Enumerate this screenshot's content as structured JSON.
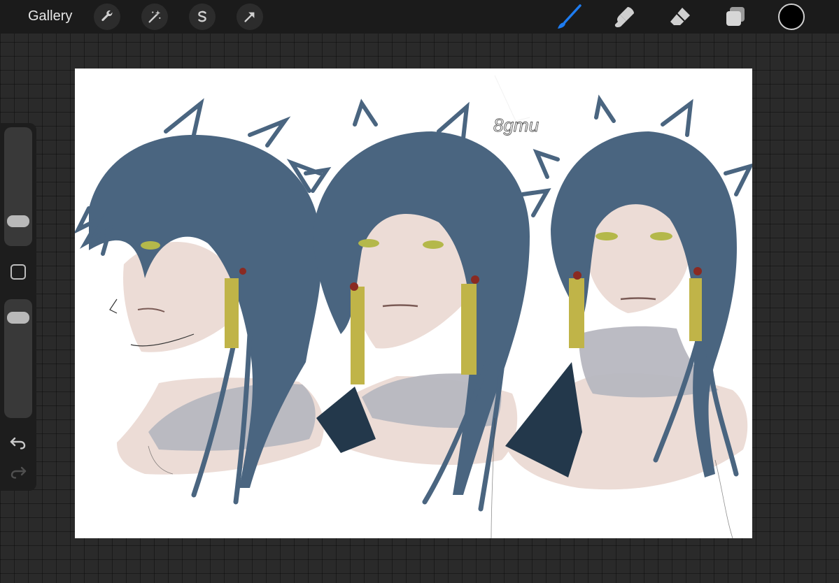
{
  "topbar": {
    "gallery_label": "Gallery",
    "actions": [
      "wrench-icon",
      "magic-wand-icon",
      "selection-icon",
      "transform-arrow-icon"
    ],
    "tools": [
      "brush-icon",
      "smudge-icon",
      "eraser-icon",
      "layers-icon"
    ],
    "active_tool": "brush",
    "current_color": "#000000"
  },
  "sidebar": {
    "brush_size_level": 0.75,
    "opacity_level": 0.17,
    "icons": [
      "modify-square-icon",
      "undo-icon",
      "redo-icon"
    ]
  },
  "canvas": {
    "signature": "8gmu",
    "colors": {
      "hair": "#4a6580",
      "skin": "#ecdcd6",
      "collar": "#b7b7c0",
      "coat": "#23384b",
      "tassel": "#c0b448",
      "eyes": "#b4b84a"
    }
  }
}
